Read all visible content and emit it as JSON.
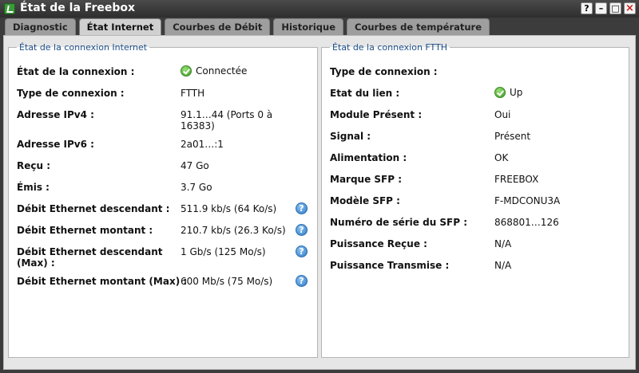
{
  "window": {
    "title": "État de la Freebox",
    "buttons": [
      "?",
      "–",
      "□",
      "×"
    ]
  },
  "tabs": [
    {
      "label": "Diagnostic",
      "active": false
    },
    {
      "label": "État Internet",
      "active": true
    },
    {
      "label": "Courbes de Débit",
      "active": false
    },
    {
      "label": "Historique",
      "active": false
    },
    {
      "label": "Courbes de température",
      "active": false
    }
  ],
  "internet": {
    "legend": "État de la connexion Internet",
    "rows": [
      {
        "label": "État de la connexion :",
        "value": "Connectée",
        "icon": "ok"
      },
      {
        "label": "Type de connexion :",
        "value": "FTTH"
      },
      {
        "label": "Adresse IPv4 :",
        "value": "91.1…44 (Ports 0 à",
        "value2": "16383)"
      },
      {
        "label": "Adresse IPv6 :",
        "value": "2a01…:1"
      },
      {
        "label": "Reçu :",
        "value": "47 Go"
      },
      {
        "label": "Émis :",
        "value": "3.7 Go"
      },
      {
        "label": "Débit Ethernet descendant :",
        "value": "511.9 kb/s (64 Ko/s)",
        "help": true
      },
      {
        "label": "Débit Ethernet montant :",
        "value": "210.7 kb/s (26.3 Ko/s)",
        "help": true
      },
      {
        "label": "Débit Ethernet descendant",
        "label2": "(Max) :",
        "value": "1 Gb/s (125 Mo/s)",
        "help": true
      },
      {
        "label": "Débit Ethernet montant (Max) :",
        "value": "600 Mb/s (75 Mo/s)",
        "help": true
      }
    ]
  },
  "ftth": {
    "legend": "État de la connexion FTTH",
    "rows": [
      {
        "label": "Type de connexion :",
        "value": ""
      },
      {
        "label": "Etat du lien :",
        "value": "Up",
        "icon": "ok"
      },
      {
        "label": "Module Présent :",
        "value": "Oui"
      },
      {
        "label": "Signal :",
        "value": "Présent"
      },
      {
        "label": "Alimentation :",
        "value": "OK"
      },
      {
        "label": "Marque SFP :",
        "value": "FREEBOX"
      },
      {
        "label": "Modèle SFP :",
        "value": "F-MDCONU3A"
      },
      {
        "label": "Numéro de série du SFP :",
        "value": "868801…126"
      },
      {
        "label": "Puissance Reçue :",
        "value": "N/A"
      },
      {
        "label": "Puissance Transmise :",
        "value": "N/A"
      }
    ]
  },
  "help_glyph": "?"
}
